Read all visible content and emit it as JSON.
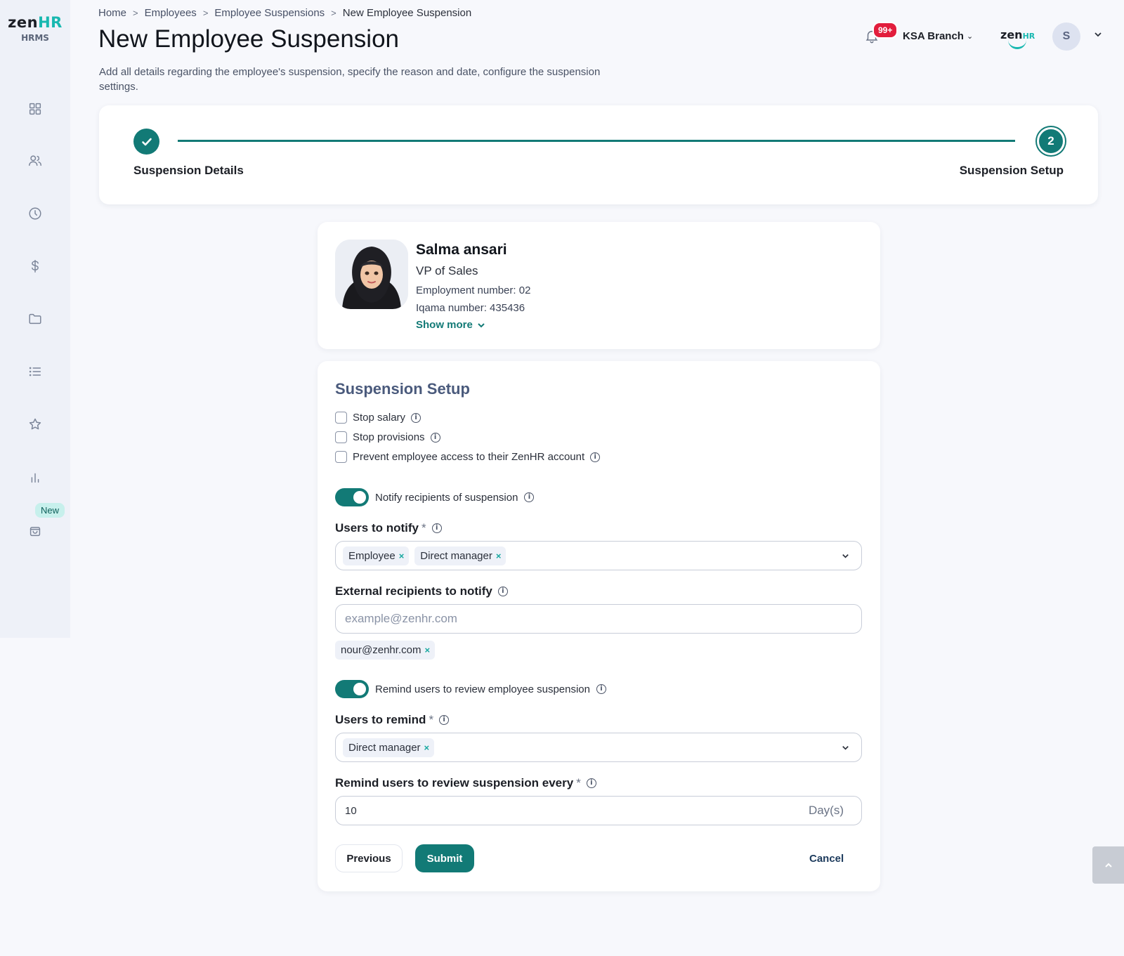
{
  "brand": {
    "logo_zen": "zen",
    "logo_hr": "HR",
    "logo_sub": "HRMS"
  },
  "sidebar": {
    "items": [
      {
        "icon": "dashboard-icon"
      },
      {
        "icon": "users-icon"
      },
      {
        "icon": "clock-icon"
      },
      {
        "icon": "dollar-icon"
      },
      {
        "icon": "folder-icon"
      },
      {
        "icon": "list-icon"
      },
      {
        "icon": "star-icon"
      },
      {
        "icon": "chart-icon"
      },
      {
        "icon": "bag-icon"
      }
    ],
    "new_badge": "New"
  },
  "breadcrumb": {
    "home": "Home",
    "employees": "Employees",
    "suspensions": "Employee Suspensions",
    "current": "New Employee Suspension"
  },
  "header": {
    "title": "New Employee Suspension",
    "description": "Add all details regarding the employee's suspension, specify the reason and date, configure the suspension settings.",
    "notification_count": "99+",
    "branch": "KSA Branch",
    "company_logo_zen": "zen",
    "company_logo_hr": "HR",
    "user_initial": "S"
  },
  "stepper": {
    "step1_label": "Suspension Details",
    "step2_number": "2",
    "step2_label": "Suspension Setup"
  },
  "employee": {
    "name": "Salma ansari",
    "role": "VP of Sales",
    "employment_number": "Employment number: 02",
    "iqama_number": "Iqama number: 435436",
    "show_more": "Show more"
  },
  "setup": {
    "title": "Suspension Setup",
    "stop_salary": "Stop salary",
    "stop_provisions": "Stop provisions",
    "prevent_access": "Prevent employee access to their ZenHR account",
    "notify_toggle": "Notify recipients of suspension",
    "users_to_notify_label": "Users to notify",
    "users_to_notify": [
      "Employee",
      "Direct manager"
    ],
    "external_label": "External recipients to notify",
    "external_placeholder": "example@zenhr.com",
    "external_recipients": [
      "nour@zenhr.com"
    ],
    "remind_toggle": "Remind users to review employee suspension",
    "users_to_remind_label": "Users to remind",
    "users_to_remind": [
      "Direct manager"
    ],
    "remind_every_label": "Remind users to review suspension every",
    "remind_every_value": "10",
    "remind_every_unit": "Day(s)",
    "required_mark": "*",
    "chip_remove": "×"
  },
  "actions": {
    "previous": "Previous",
    "submit": "Submit",
    "cancel": "Cancel"
  },
  "colors": {
    "primary": "#127a76",
    "accent": "#18b8b0",
    "badge_red": "#e21d3c"
  }
}
